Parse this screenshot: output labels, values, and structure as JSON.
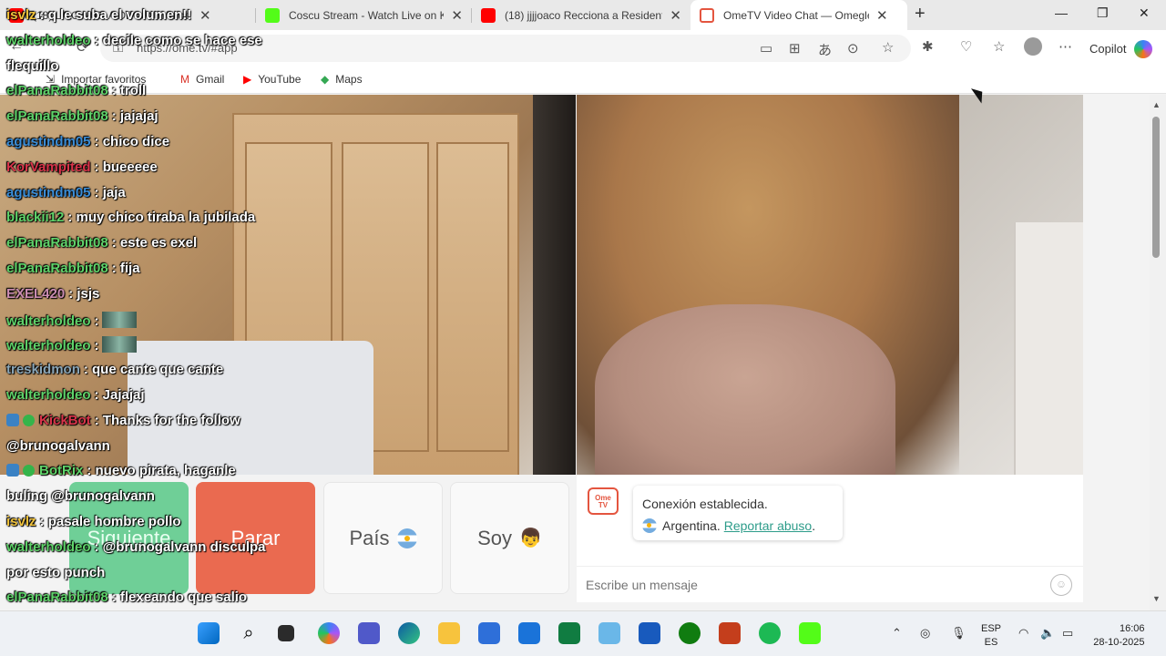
{
  "browser": {
    "tabs": [
      {
        "title": "(18) LA CHARLA DE ... YouTube",
        "active": false
      },
      {
        "title": "Coscu Stream - Watch Live on Kick",
        "active": false
      },
      {
        "title": "(18) jjjjoaco Recciona a Residente",
        "active": false
      },
      {
        "title": "OmeTV Video Chat — Omegle",
        "active": true
      }
    ],
    "url": "https://ome.tv/#app",
    "copilot_label": "Copilot",
    "bookmarks": [
      "Importar favoritos",
      "Gmail",
      "YouTube",
      "Maps"
    ]
  },
  "ometv": {
    "buttons": {
      "next": "Siguiente",
      "stop": "Parar",
      "country": "País",
      "gender": "Soy"
    },
    "bubble": {
      "line1": "Conexión establecida.",
      "country": "Argentina.",
      "report": "Reportar abuso",
      "end": "."
    },
    "message_placeholder": "Escribe un mensaje",
    "logo_text": "Ome TV"
  },
  "chat_overlay": [
    {
      "user": "isvlz",
      "text": ": q le suba el volumen!!",
      "color": "#f0c23b"
    },
    {
      "user": "walterholdeo",
      "text": ": decile como se hace ese",
      "color": "#5fd36a"
    },
    {
      "user": "",
      "text": "flequillo",
      "color": "#ffffff"
    },
    {
      "user": "elPanaRabbit08",
      "text": ": troll",
      "color": "#5fd36a"
    },
    {
      "user": "elPanaRabbit08",
      "text": ": jajajaj",
      "color": "#5fd36a"
    },
    {
      "user": "agustindm05",
      "text": ": chico dice",
      "color": "#3b8ed8"
    },
    {
      "user": "KorVampited",
      "text": ": bueeeee",
      "color": "#d8344a"
    },
    {
      "user": "agustindm05",
      "text": ": jaja",
      "color": "#3b8ed8"
    },
    {
      "user": "blackii12",
      "text": ": muy chico tiraba la jubilada",
      "color": "#5fd36a"
    },
    {
      "user": "elPanaRabbit08",
      "text": ": este es exel",
      "color": "#5fd36a"
    },
    {
      "user": "elPanaRabbit08",
      "text": ": fija",
      "color": "#5fd36a"
    },
    {
      "user": "EXEL420",
      "text": ": jsjs",
      "color": "#c98bb0"
    },
    {
      "user": "walterholdeo",
      "text": ":",
      "color": "#5fd36a",
      "emote": true
    },
    {
      "user": "walterholdeo",
      "text": ":",
      "color": "#5fd36a",
      "emote": true
    },
    {
      "user": "treskidmon",
      "text": ": que cante que cante",
      "color": "#8aa6b8"
    },
    {
      "user": "walterholdeo",
      "text": ": Jajajaj",
      "color": "#5fd36a"
    },
    {
      "user": "KickBot",
      "text": ": Thanks for the follow",
      "color": "#d8344a",
      "badges": true
    },
    {
      "user": "",
      "text": "@brunogalvann",
      "color": "#ffffff"
    },
    {
      "user": "BotRix",
      "text": ": nuevo pirata, haganle",
      "color": "#5fd36a",
      "badges": true
    },
    {
      "user": "",
      "text": "buling @brunogalvann",
      "color": "#ffffff"
    },
    {
      "user": "isvlz",
      "text": ": pasale hombre pollo",
      "color": "#f0c23b"
    },
    {
      "user": "walterholdeo",
      "text": ": @brunogalvann disculpa",
      "color": "#5fd36a"
    },
    {
      "user": "",
      "text": "por esto punch",
      "color": "#ffffff"
    },
    {
      "user": "elPanaRabbit08",
      "text": ": flexeando que salio",
      "color": "#5fd36a"
    }
  ],
  "taskbar": {
    "lang_top": "ESP",
    "lang_bottom": "ES",
    "time": "16:06",
    "date": "28-10-2025",
    "icons": [
      "start",
      "search",
      "task-view",
      "copilot",
      "teams",
      "edge",
      "explorer",
      "store",
      "mail",
      "excel",
      "photos",
      "word",
      "xbox",
      "powerpoint",
      "spotify",
      "kick"
    ]
  }
}
